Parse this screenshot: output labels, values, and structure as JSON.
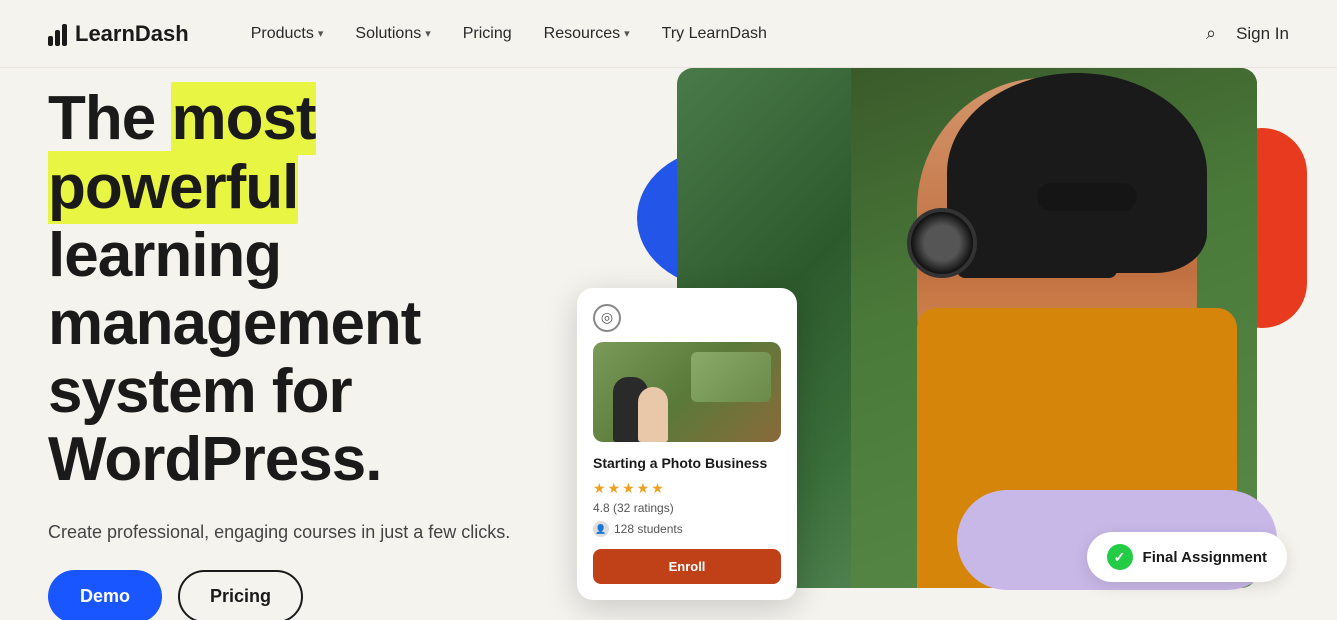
{
  "nav": {
    "logo_text": "LearnDash",
    "links": [
      {
        "label": "Products",
        "has_chevron": true
      },
      {
        "label": "Solutions",
        "has_chevron": true
      },
      {
        "label": "Pricing",
        "has_chevron": false
      },
      {
        "label": "Resources",
        "has_chevron": true
      },
      {
        "label": "Try LearnDash",
        "has_chevron": false
      }
    ],
    "sign_in": "Sign In"
  },
  "hero": {
    "title_before": "The ",
    "title_highlight": "most powerful",
    "title_after": " learning management system for WordPress.",
    "subtitle": "Create professional, engaging courses in just a few clicks.",
    "btn_demo": "Demo",
    "btn_pricing": "Pricing"
  },
  "course_card": {
    "title": "Starting a Photo Business",
    "stars": "★★★★★",
    "rating": "4.8 (32 ratings)",
    "students": "128 students",
    "enroll": "Enroll"
  },
  "assignment_badge": {
    "text": "Final Assignment",
    "check": "✓"
  }
}
